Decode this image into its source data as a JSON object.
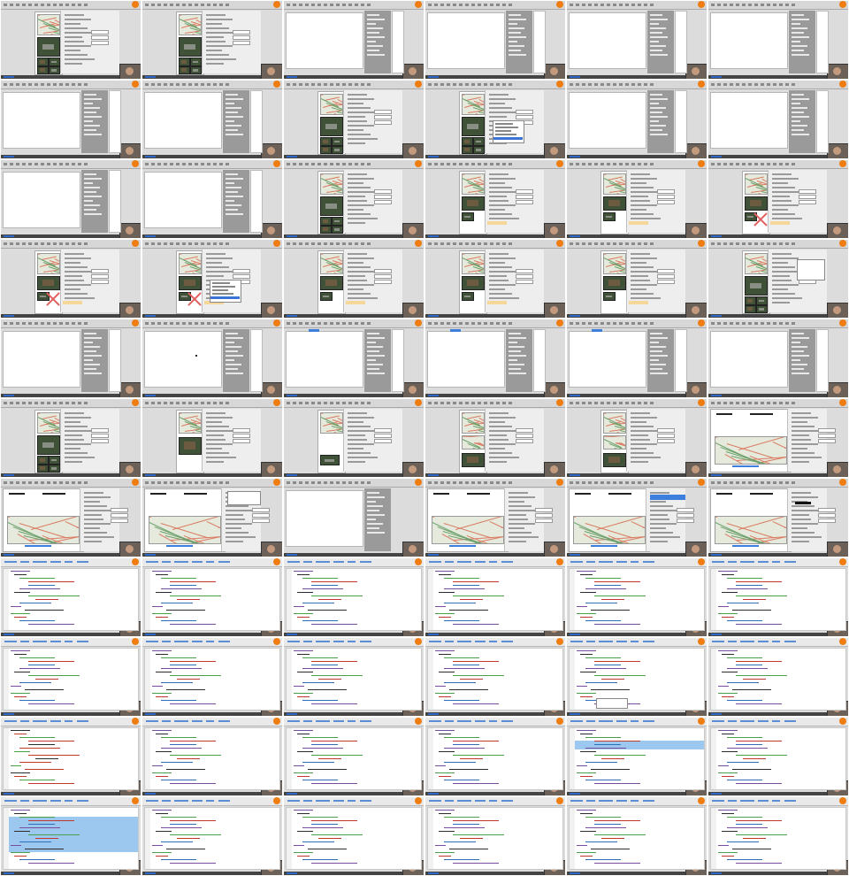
{
  "sheet": {
    "columns": 6,
    "rows": 11,
    "tile_count": 66,
    "app_logo_icon": "orange-circle-logo",
    "status_bar_color": "#444444",
    "accent_blue": "#3d7fdc",
    "highlight_blue": "#9cc7ef",
    "warning_x_color": "#e36060"
  },
  "tiles": [
    "map-layout",
    "map-layout",
    "text-editor-panel",
    "blank-list-panel",
    "blank-list-panel",
    "blank-list-panel",
    "text-editor-panel",
    "text-editor-panel",
    "map-layout",
    "map-layout-dropdown",
    "blank-list-panel",
    "blank-list-panel",
    "text-editor-panel",
    "text-editor-panel",
    "map-layout",
    "map-layout-single",
    "map-layout-single",
    "map-layout-x",
    "map-layout-x",
    "map-layout-x-dropdown",
    "map-layout-single",
    "map-layout-single",
    "map-layout-single",
    "map-layout-dialog",
    "blank-canvas",
    "blank-canvas-dot",
    "blank-canvas-tab",
    "blank-canvas-tab",
    "blank-canvas-tab",
    "blank-canvas",
    "map-layout",
    "map-layout-photo",
    "map-layout-small",
    "map-layout-two",
    "map-layout-two",
    "report-landscape",
    "report-landscape",
    "report-landscape-form",
    "code-panel-green",
    "report-landscape",
    "report-landscape-blue",
    "report-landscape-black",
    "code-editor",
    "code-editor",
    "code-editor",
    "code-editor",
    "code-editor",
    "code-editor",
    "code-editor",
    "code-editor",
    "code-editor",
    "code-editor",
    "code-editor-popup",
    "code-editor",
    "code-editor-red",
    "code-editor",
    "code-editor",
    "code-editor",
    "code-editor-highlight",
    "code-editor",
    "code-editor-bigsel",
    "code-editor",
    "code-editor",
    "code-editor",
    "code-editor",
    "code-editor"
  ]
}
